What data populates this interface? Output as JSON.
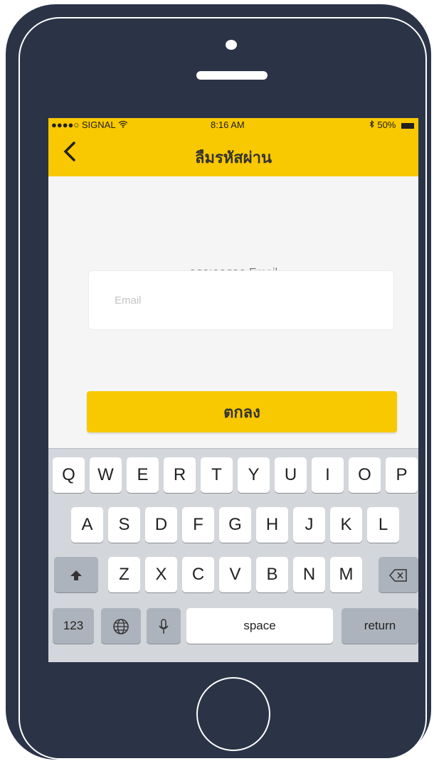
{
  "status_bar": {
    "carrier": "●●●●○ SIGNAL",
    "wifi_icon": "wifi-icon",
    "time": "8:16 AM",
    "bluetooth_icon": "bluetooth-icon",
    "battery": "50%"
  },
  "header": {
    "back_icon": "chevron-left-icon",
    "title": "ลืมรหัสผ่าน"
  },
  "form": {
    "prompt": "กรุณากรอก  Email",
    "email_placeholder": "Email",
    "email_value": "",
    "submit_label": "ตกลง"
  },
  "keyboard": {
    "row1": [
      "Q",
      "W",
      "E",
      "R",
      "T",
      "Y",
      "U",
      "I",
      "O",
      "P"
    ],
    "row2": [
      "A",
      "S",
      "D",
      "F",
      "G",
      "H",
      "J",
      "K",
      "L"
    ],
    "row3": [
      "Z",
      "X",
      "C",
      "V",
      "B",
      "N",
      "M"
    ],
    "shift_icon": "shift-icon",
    "backspace_icon": "backspace-icon",
    "numbers_label": "123",
    "globe_icon": "globe-icon",
    "mic_icon": "microphone-icon",
    "space_label": "space",
    "return_label": "return"
  },
  "colors": {
    "accent": "#f8c800",
    "device_frame": "#2b3447",
    "screen_background": "#f5f5f5",
    "keyboard_background": "#d3d6db"
  }
}
